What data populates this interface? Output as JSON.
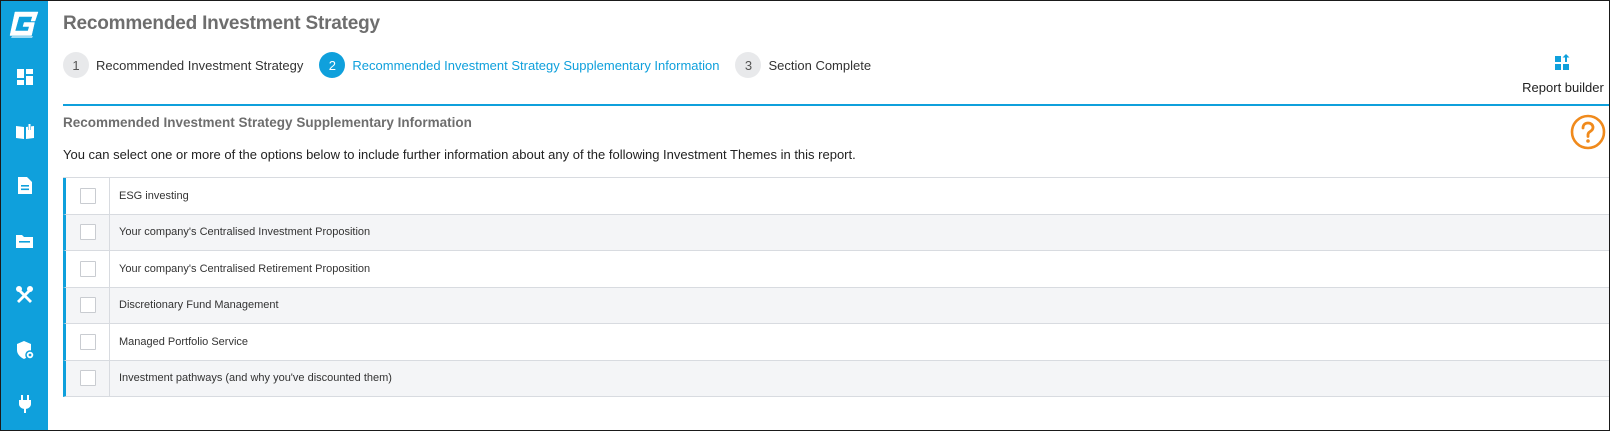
{
  "page": {
    "title": "Recommended Investment Strategy"
  },
  "sidebar": {
    "items": [
      {
        "icon": "dashboard-icon"
      },
      {
        "icon": "book-icon"
      },
      {
        "icon": "document-icon"
      },
      {
        "icon": "folder-icon"
      },
      {
        "icon": "tools-icon"
      },
      {
        "icon": "shield-icon"
      },
      {
        "icon": "plug-icon"
      }
    ]
  },
  "stepper": {
    "steps": [
      {
        "number": "1",
        "label": "Recommended Investment Strategy",
        "active": false
      },
      {
        "number": "2",
        "label": "Recommended Investment Strategy Supplementary Information",
        "active": true
      },
      {
        "number": "3",
        "label": "Section Complete",
        "active": false
      }
    ]
  },
  "report_builder": {
    "label": "Report builder",
    "icon": "report-builder-icon"
  },
  "section": {
    "title": "Recommended Investment Strategy Supplementary Information",
    "intro": "You can select one or more of the options below to include further information about any of the following Investment Themes in this report.",
    "help_icon": "help-icon"
  },
  "options": [
    {
      "label": "ESG investing",
      "checked": false
    },
    {
      "label": "Your company's Centralised Investment Proposition",
      "checked": false
    },
    {
      "label": "Your company's Centralised Retirement Proposition",
      "checked": false
    },
    {
      "label": "Discretionary Fund Management",
      "checked": false
    },
    {
      "label": "Managed Portfolio Service",
      "checked": false
    },
    {
      "label": "Investment pathways (and why you've discounted them)",
      "checked": false
    }
  ],
  "colors": {
    "accent": "#0fa0dc",
    "help": "#f08a1c",
    "title_gray": "#6e6e6e"
  }
}
